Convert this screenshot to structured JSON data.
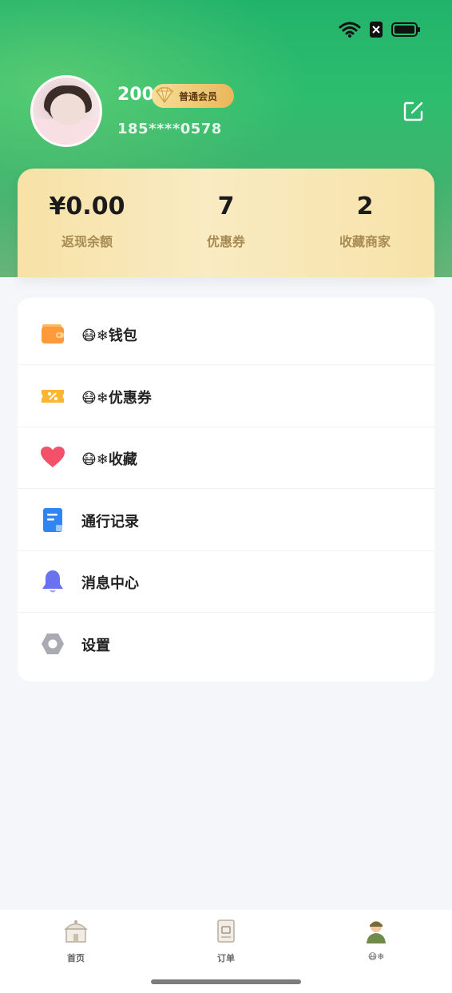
{
  "profile": {
    "nickname": "200",
    "level": "普通会员",
    "phone": "185****0578"
  },
  "stats": [
    {
      "value": "¥0.00",
      "label": "返现余额"
    },
    {
      "value": "7",
      "label": "优惠券"
    },
    {
      "value": "2",
      "label": "收藏商家"
    }
  ],
  "menu": {
    "wallet": "😷❄钱包",
    "coupons": "😷❄优惠券",
    "favorites": "😷❄收藏",
    "records": "通行记录",
    "messages": "消息中心",
    "settings": "设置"
  },
  "tabbar": {
    "home": "首页",
    "orders": "订单",
    "mine": "😷❄"
  },
  "colors": {
    "header_green": "#2dbd6e",
    "card_gold": "#f7e1a6",
    "stat_label": "#a88b52"
  },
  "icons": [
    "wifi-icon",
    "battery-icon",
    "edit-icon",
    "wallet-icon",
    "coupon-icon",
    "heart-icon",
    "document-icon",
    "bell-icon",
    "gear-icon",
    "home-icon",
    "orders-icon",
    "profile-icon"
  ]
}
